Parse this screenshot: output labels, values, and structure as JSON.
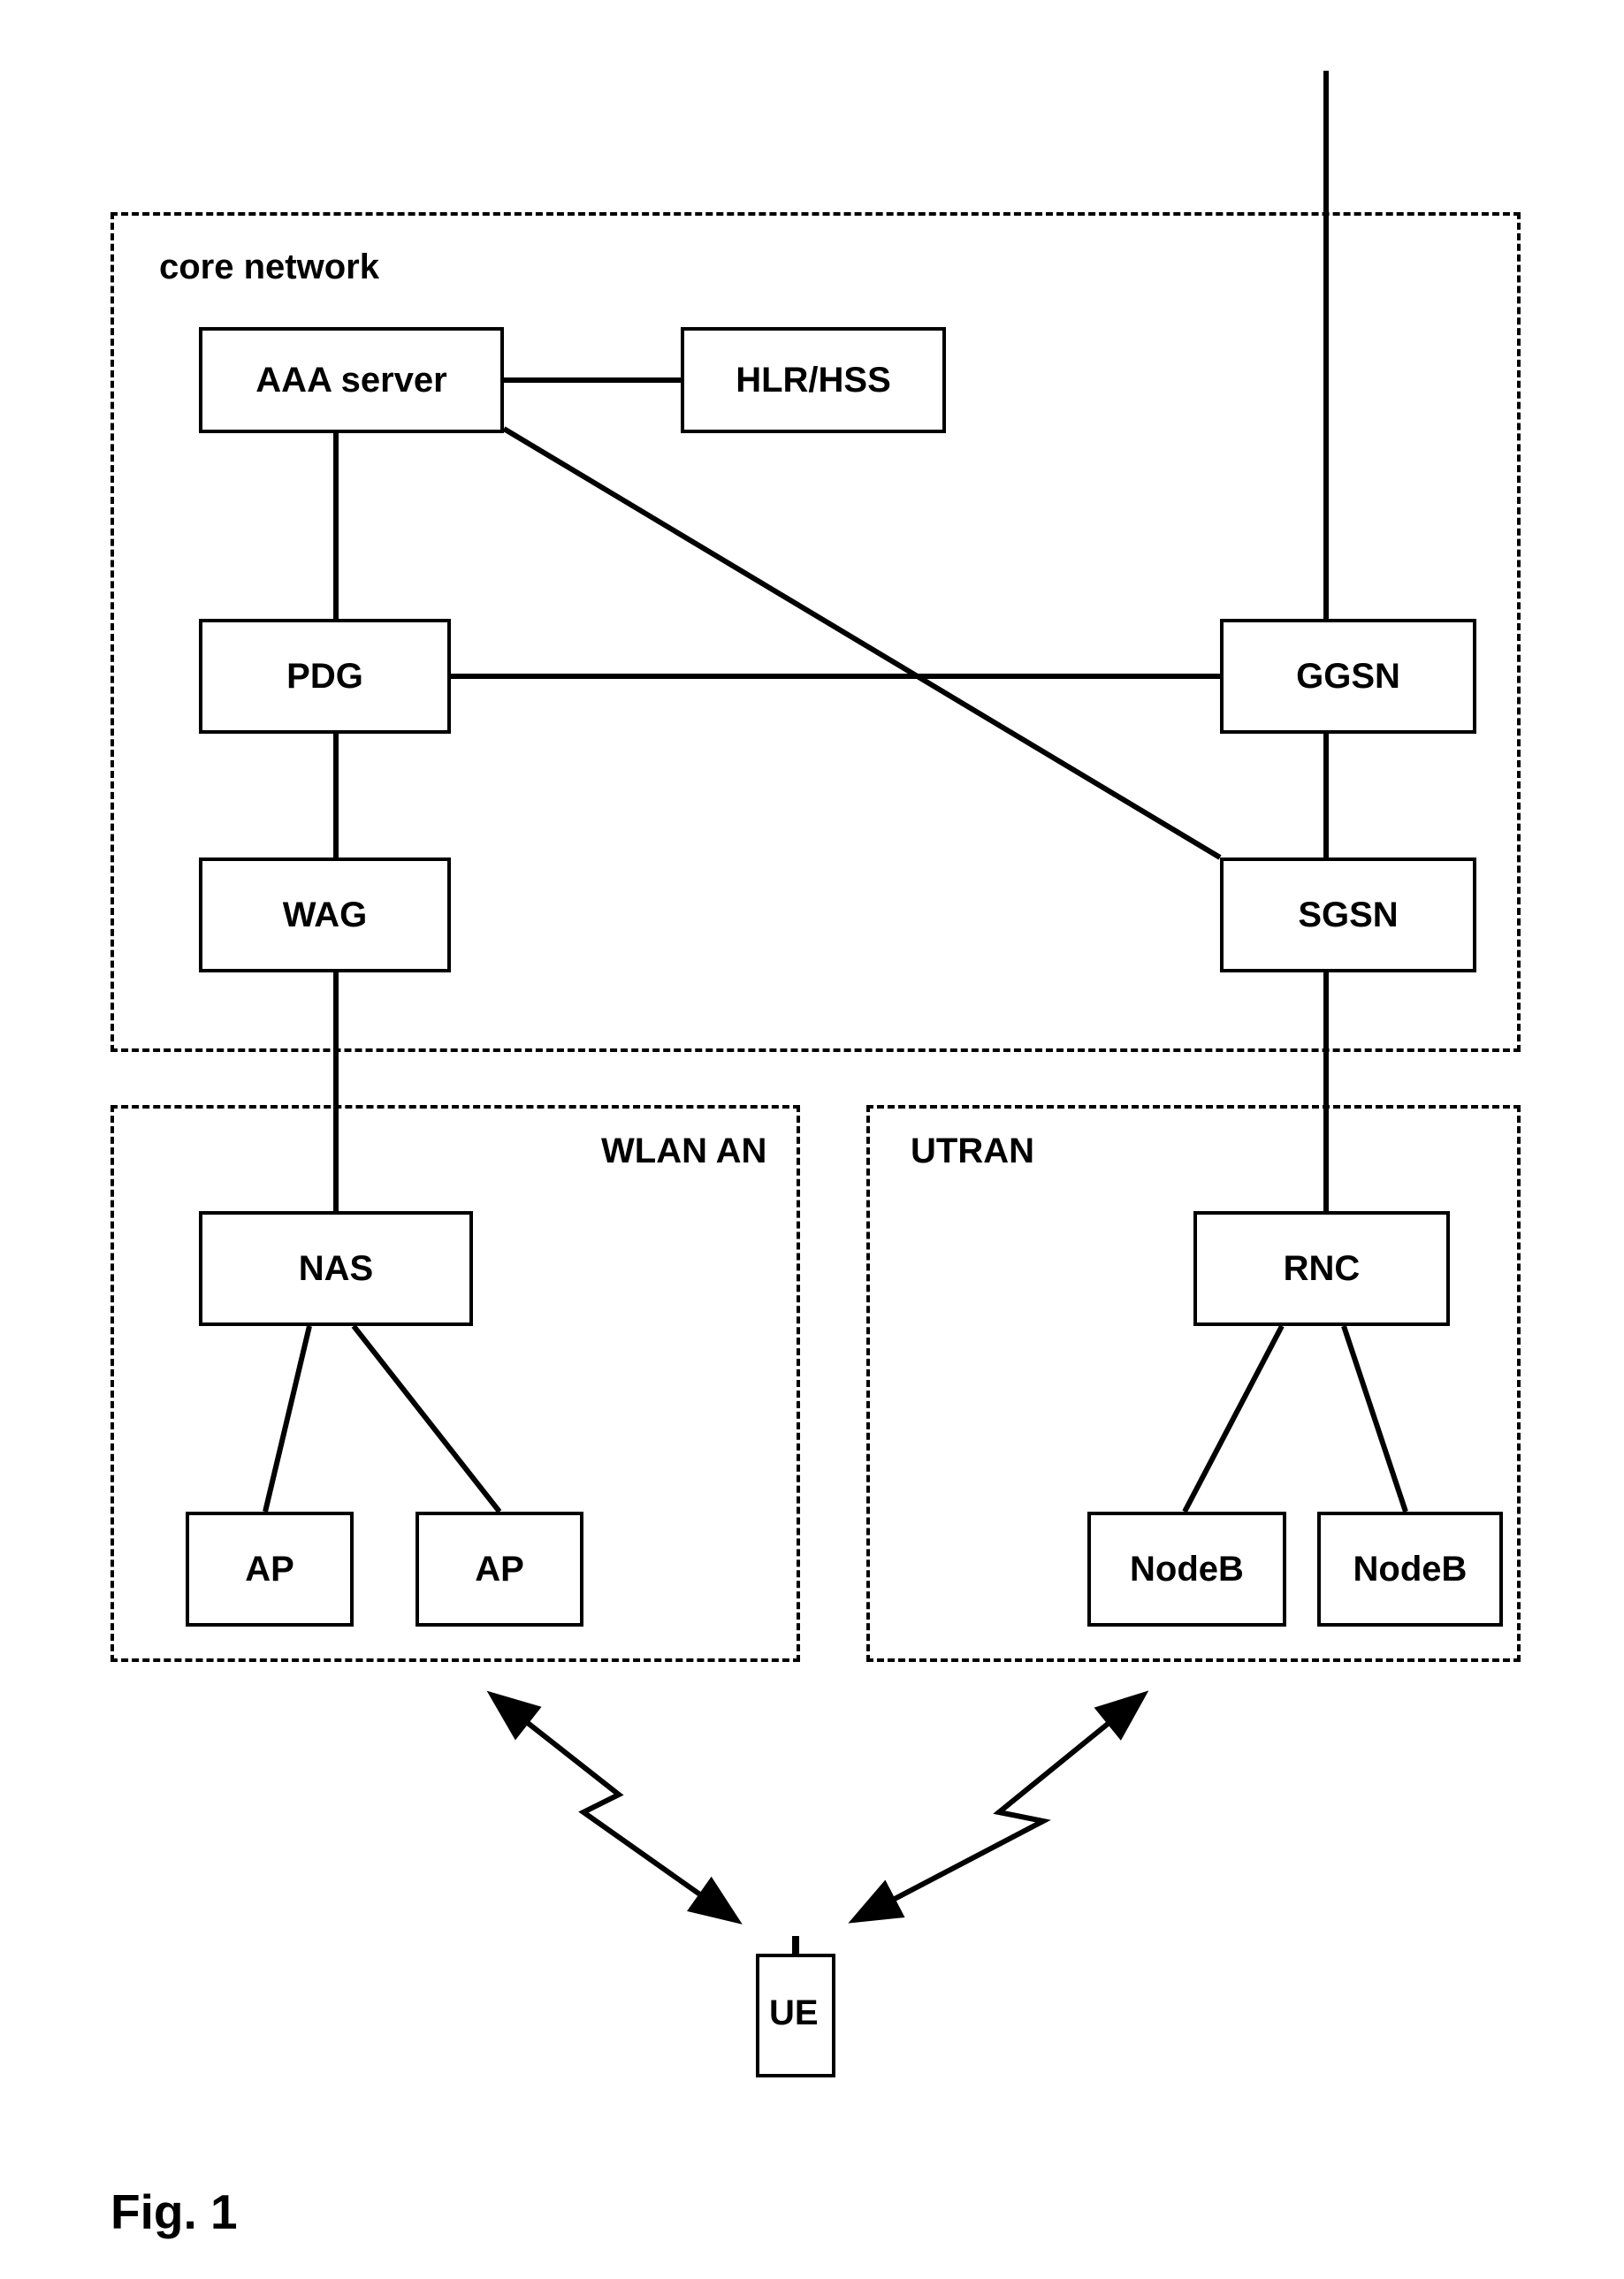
{
  "regions": {
    "core": {
      "label": "core network"
    },
    "wlan": {
      "label": "WLAN AN"
    },
    "utran": {
      "label": "UTRAN"
    }
  },
  "nodes": {
    "aaa": "AAA server",
    "hlr": "HLR/HSS",
    "pdg": "PDG",
    "ggsn": "GGSN",
    "wag": "WAG",
    "sgsn": "SGSN",
    "nas": "NAS",
    "rnc": "RNC",
    "ap1": "AP",
    "ap2": "AP",
    "nodeb1": "NodeB",
    "nodeb2": "NodeB",
    "ue": "UE"
  },
  "figure": {
    "label": "Fig. 1"
  }
}
